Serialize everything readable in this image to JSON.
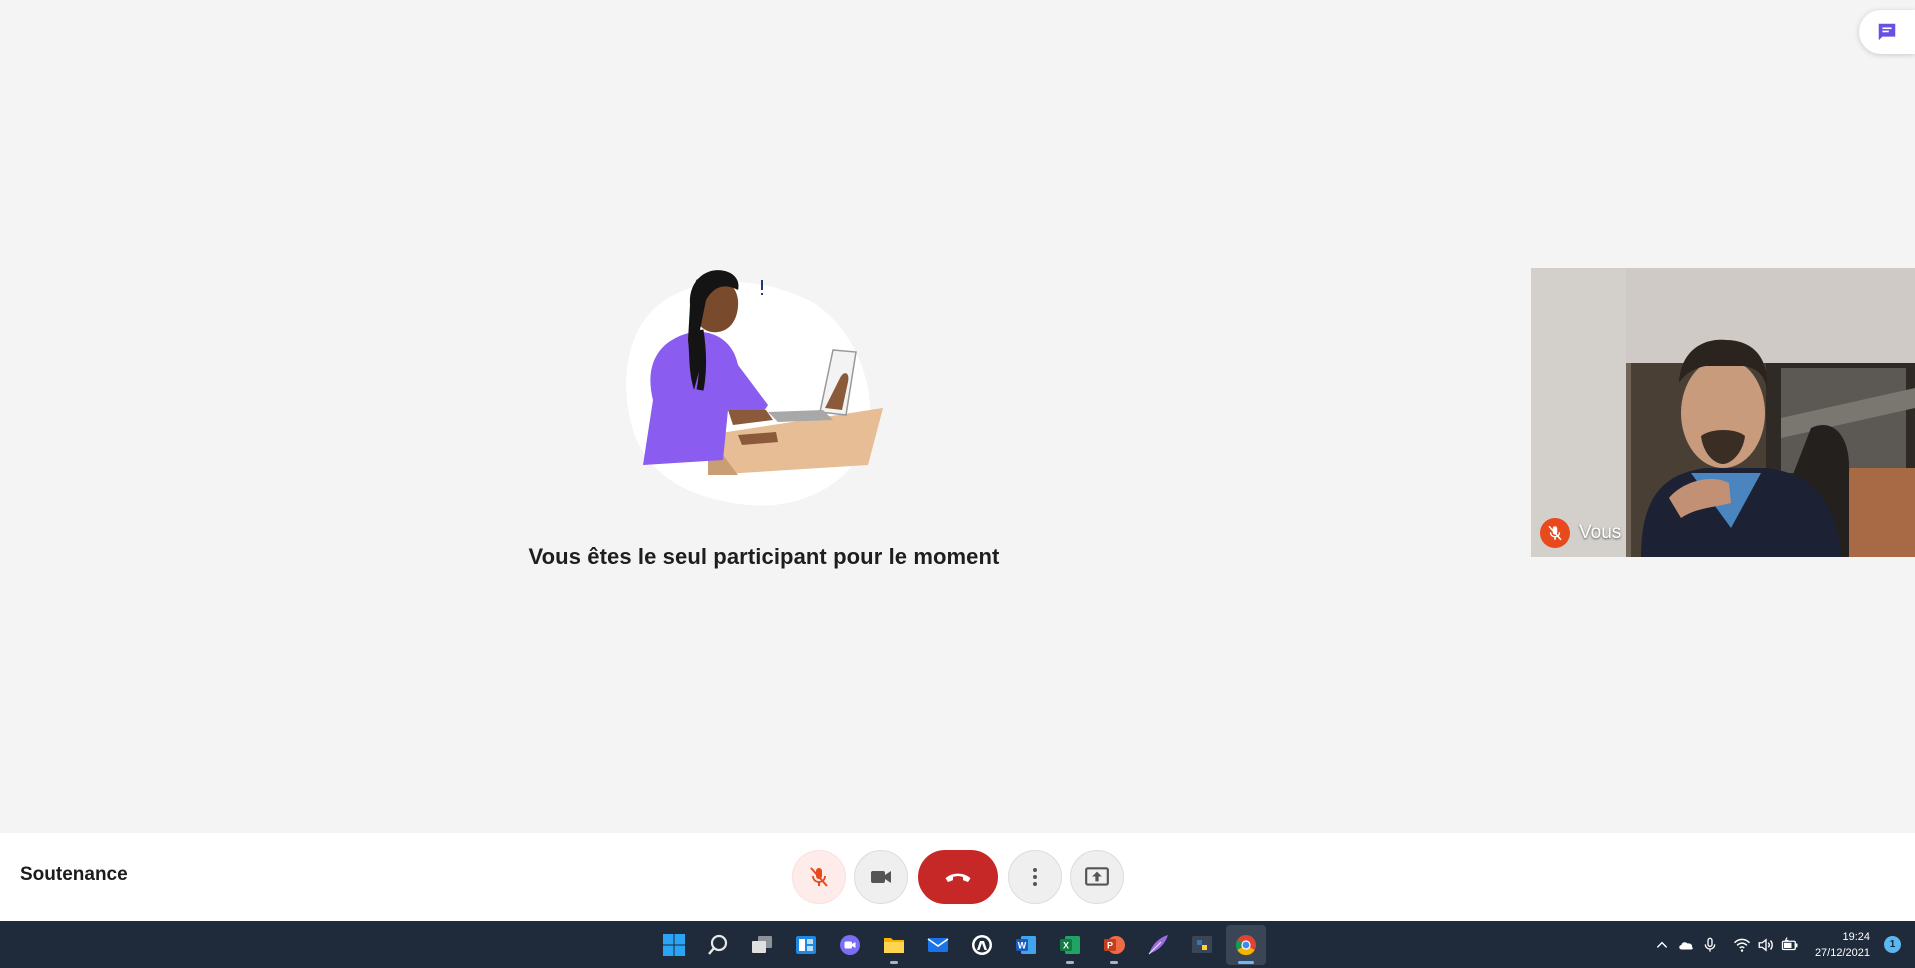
{
  "main": {
    "empty_message": "Vous êtes le seul participant pour le moment",
    "illustration_icon": "person-waiting-at-laptop"
  },
  "chat_button": {
    "icon": "chat-icon",
    "accent": "#6b4ee6"
  },
  "self_view": {
    "name": "Vous",
    "mic_state": "muted",
    "badge_color": "#e8491d"
  },
  "bottom_bar": {
    "meeting_title": "Soutenance",
    "controls": [
      {
        "id": "mic",
        "icon": "mic-off-icon",
        "state": "off"
      },
      {
        "id": "camera",
        "icon": "camera-icon"
      },
      {
        "id": "hangup",
        "icon": "phone-hangup-icon",
        "color": "#c62828"
      },
      {
        "id": "more",
        "icon": "more-vertical-icon"
      },
      {
        "id": "share",
        "icon": "screen-share-icon"
      }
    ]
  },
  "taskbar": {
    "apps": [
      "start",
      "search",
      "task-view",
      "widgets",
      "chat",
      "file-explorer",
      "mail",
      "app",
      "word",
      "excel",
      "powerpoint",
      "quill",
      "python",
      "chrome"
    ],
    "active_app": "chrome",
    "time": "19:24",
    "date": "27/12/2021",
    "notification_count": "1"
  }
}
